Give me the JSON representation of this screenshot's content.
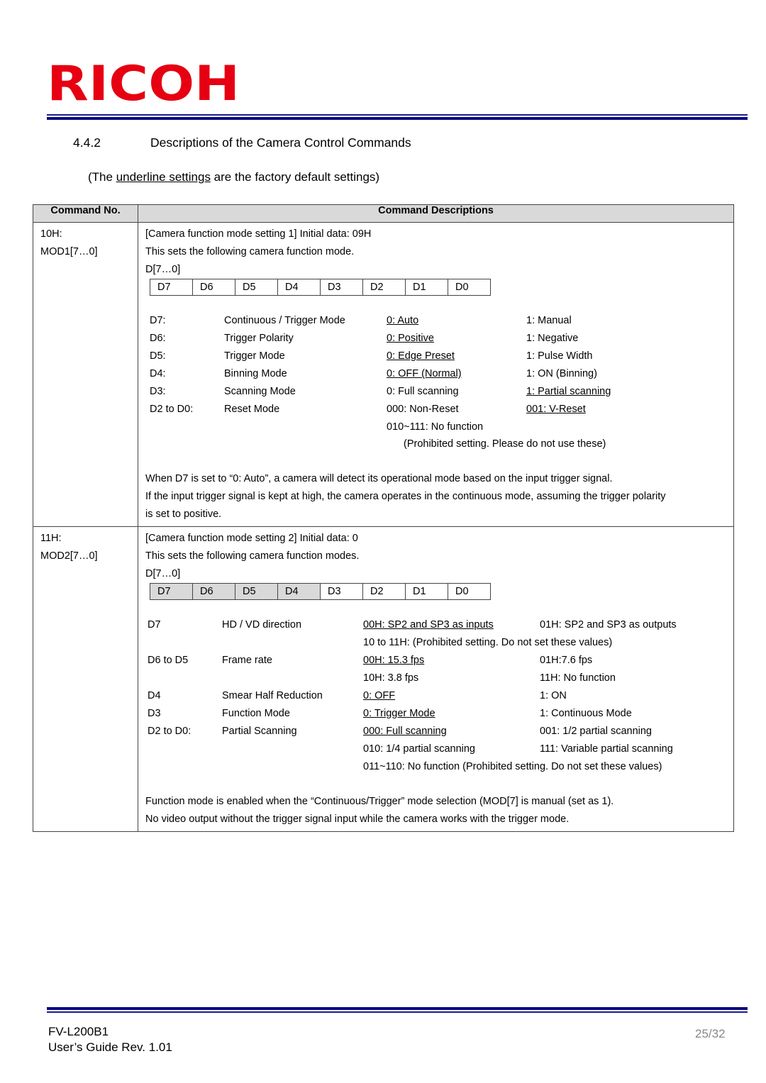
{
  "header": {
    "logo_text": "RICOH",
    "logo_color": "#e60012",
    "rule_color": "#0a0a80"
  },
  "section": {
    "number": "4.4.2",
    "title": "Descriptions of the Camera Control Commands"
  },
  "note": {
    "prefix": "(The ",
    "underlined": "underline settings",
    "suffix": " are the factory default settings)"
  },
  "table": {
    "headers": [
      "Command No.",
      "Command Descriptions"
    ],
    "rows": [
      {
        "cmd_lines": [
          "10H:",
          "MOD1[7…0]"
        ],
        "title": "[Camera function mode setting 1] Initial data: 09H",
        "intro": "This sets the following camera function mode.",
        "bits_label": "D[7…0]",
        "bits": [
          "D7",
          "D6",
          "D5",
          "D4",
          "D3",
          "D2",
          "D1",
          "D0"
        ],
        "shaded_bits": [],
        "specs": [
          {
            "bit": "D7:",
            "name": "Continuous / Trigger Mode",
            "opt0": "0: Auto",
            "opt0_default": true,
            "opt1": "1: Manual",
            "opt1_default": false
          },
          {
            "bit": "D6:",
            "name": "Trigger Polarity",
            "opt0": "0: Positive",
            "opt0_default": true,
            "opt1": "1: Negative",
            "opt1_default": false
          },
          {
            "bit": "D5:",
            "name": "Trigger Mode",
            "opt0": "0: Edge Preset",
            "opt0_default": true,
            "opt1": "1: Pulse Width",
            "opt1_default": false
          },
          {
            "bit": "D4:",
            "name": "Binning Mode",
            "opt0": "0: OFF (Normal)",
            "opt0_default": true,
            "opt1": "1: ON (Binning)",
            "opt1_default": false
          },
          {
            "bit": "D3:",
            "name": "Scanning Mode",
            "opt0": "0: Full scanning",
            "opt0_default": false,
            "opt1": "1: Partial scanning",
            "opt1_default": true
          },
          {
            "bit": "D2 to D0:",
            "name": "Reset Mode",
            "opt0": "000: Non-Reset",
            "opt0_default": false,
            "opt1": "001: V-Reset",
            "opt1_default": true
          },
          {
            "bit": "",
            "name": "",
            "opt0": "010~111: No function",
            "opt0_default": false,
            "opt1": "",
            "opt1_default": false
          }
        ],
        "prohibited_note": "(Prohibited setting. Please do not use these)",
        "remarks": [
          "When D7 is set to “0: Auto”, a camera will detect its operational mode based on the input trigger signal.",
          "If the input trigger signal is kept at high, the camera operates in the continuous mode, assuming the trigger polarity",
          "is set to positive."
        ]
      },
      {
        "cmd_lines": [
          "11H:",
          "MOD2[7…0]"
        ],
        "title": "[Camera function mode setting 2] Initial data: 0",
        "intro": "This sets the following camera function modes.",
        "bits_label": "D[7…0]",
        "bits": [
          "D7",
          "D6",
          "D5",
          "D4",
          "D3",
          "D2",
          "D1",
          "D0"
        ],
        "shaded_bits": [
          "D7",
          "D6",
          "D5",
          "D4"
        ],
        "specs": [
          {
            "bit": "D7",
            "name": "HD / VD direction",
            "opt0": "00H: SP2 and SP3 as inputs",
            "opt0_default": true,
            "opt1": "01H: SP2 and SP3 as outputs",
            "opt1_default": false
          },
          {
            "bit": "",
            "name": "",
            "opt0": "10 to 11H: (Prohibited setting. Do not set these values)",
            "opt0_default": false,
            "opt1": "",
            "opt1_default": false
          },
          {
            "bit": "D6 to D5",
            "name": "Frame rate",
            "opt0": "00H: 15.3 fps",
            "opt0_default": true,
            "opt1": "01H:7.6 fps",
            "opt1_default": false
          },
          {
            "bit": "",
            "name": "",
            "opt0": "10H: 3.8 fps",
            "opt0_default": false,
            "opt1": "11H: No function",
            "opt1_default": false
          },
          {
            "bit": "D4",
            "name": "Smear Half Reduction",
            "opt0": "0: OFF",
            "opt0_default": true,
            "opt1": "1: ON",
            "opt1_default": false
          },
          {
            "bit": "D3",
            "name": "Function Mode",
            "opt0": "0: Trigger Mode",
            "opt0_default": true,
            "opt1": "1: Continuous Mode",
            "opt1_default": false
          },
          {
            "bit": "D2 to D0:",
            "name": "Partial Scanning",
            "opt0": "000: Full scanning",
            "opt0_default": true,
            "opt1": "001: 1/2 partial scanning",
            "opt1_default": false
          },
          {
            "bit": "",
            "name": "",
            "opt0": "010: 1/4 partial scanning",
            "opt0_default": false,
            "opt1": "111: Variable partial scanning",
            "opt1_default": false
          },
          {
            "bit": "",
            "name": "",
            "opt0": "011~110: No function (Prohibited setting. Do not set these values)",
            "opt0_default": false,
            "opt1": "",
            "opt1_default": false
          }
        ],
        "prohibited_note": "",
        "remarks": [
          "Function mode is enabled when the “Continuous/Trigger” mode selection (MOD[7] is manual (set as 1).",
          "No video output without the trigger signal input while the camera works with the trigger mode."
        ]
      }
    ]
  },
  "footer": {
    "model": "FV-L200B1",
    "guide": "User’s Guide Rev. 1.01",
    "page": "25/32"
  }
}
